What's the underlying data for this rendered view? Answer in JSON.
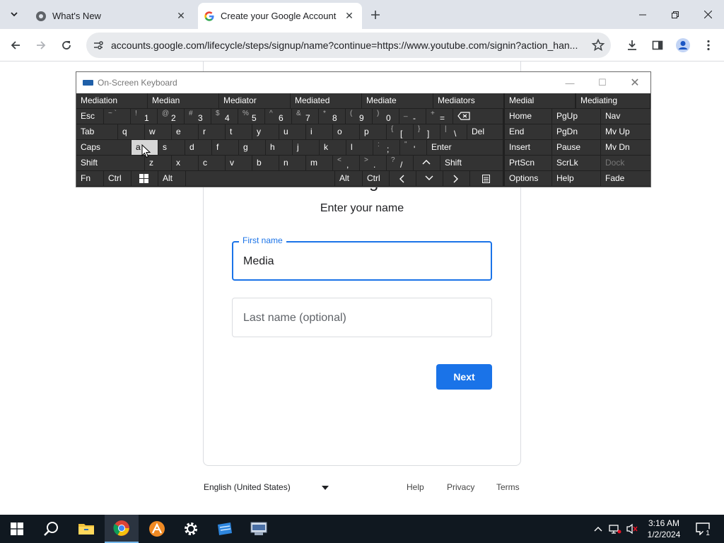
{
  "browser": {
    "tabs": [
      {
        "title": "What's New",
        "active": false
      },
      {
        "title": "Create your Google Account",
        "active": true
      }
    ],
    "url": "accounts.google.com/lifecycle/steps/signup/name?continue=https://www.youtube.com/signin?action_han..."
  },
  "page": {
    "heading": "Create a Google Account",
    "subheading": "Enter your name",
    "first_name": {
      "label": "First name",
      "value": "Media"
    },
    "last_name": {
      "placeholder": "Last name (optional)"
    },
    "next_label": "Next",
    "footer": {
      "language": "English (United States)",
      "help": "Help",
      "privacy": "Privacy",
      "terms": "Terms"
    }
  },
  "osk": {
    "title": "On-Screen Keyboard",
    "predictions": [
      "Mediation",
      "Median",
      "Mediator",
      "Mediated",
      "Mediate",
      "Mediators",
      "Medial",
      "Mediating"
    ],
    "keys": {
      "esc": "Esc",
      "tab": "Tab",
      "caps": "Caps",
      "shift": "Shift",
      "shift_r": "Shift",
      "fn": "Fn",
      "ctrl": "Ctrl",
      "alt": "Alt",
      "alt_r": "Alt",
      "ctrl_r": "Ctrl",
      "del": "Del",
      "enter": "Enter",
      "home": "Home",
      "pgup": "PgUp",
      "nav": "Nav",
      "end": "End",
      "pgdn": "PgDn",
      "mvup": "Mv Up",
      "insert": "Insert",
      "pause": "Pause",
      "mvdn": "Mv Dn",
      "prtscn": "PrtScn",
      "scrlk": "ScrLk",
      "dock": "Dock",
      "options": "Options",
      "help": "Help",
      "fade": "Fade",
      "num": [
        {
          "sub": "~ `",
          "main": ""
        },
        {
          "sub": "!",
          "main": "1"
        },
        {
          "sub": "@",
          "main": "2"
        },
        {
          "sub": "#",
          "main": "3"
        },
        {
          "sub": "$",
          "main": "4"
        },
        {
          "sub": "%",
          "main": "5"
        },
        {
          "sub": "^",
          "main": "6"
        },
        {
          "sub": "&",
          "main": "7"
        },
        {
          "sub": "*",
          "main": "8"
        },
        {
          "sub": "(",
          "main": "9"
        },
        {
          "sub": ")",
          "main": "0"
        },
        {
          "sub": "_",
          "main": "-"
        },
        {
          "sub": "+",
          "main": "="
        }
      ],
      "row_q": [
        "q",
        "w",
        "e",
        "r",
        "t",
        "y",
        "u",
        "i",
        "o",
        "p"
      ],
      "row_q_sym": [
        {
          "sub": "{",
          "main": "["
        },
        {
          "sub": "}",
          "main": "]"
        },
        {
          "sub": "|",
          "main": "\\"
        }
      ],
      "row_a": [
        "a",
        "s",
        "d",
        "f",
        "g",
        "h",
        "j",
        "k",
        "l"
      ],
      "row_a_sym": [
        {
          "sub": ":",
          "main": ";"
        },
        {
          "sub": "\"",
          "main": "'"
        }
      ],
      "row_z": [
        "z",
        "x",
        "c",
        "v",
        "b",
        "n",
        "m"
      ],
      "row_z_sym": [
        {
          "sub": "<",
          "main": ","
        },
        {
          "sub": ">",
          "main": "."
        },
        {
          "sub": "?",
          "main": "/"
        }
      ]
    },
    "pressed_key": "a"
  },
  "taskbar": {
    "time": "3:16 AM",
    "date": "1/2/2024",
    "notification_count": "1"
  }
}
